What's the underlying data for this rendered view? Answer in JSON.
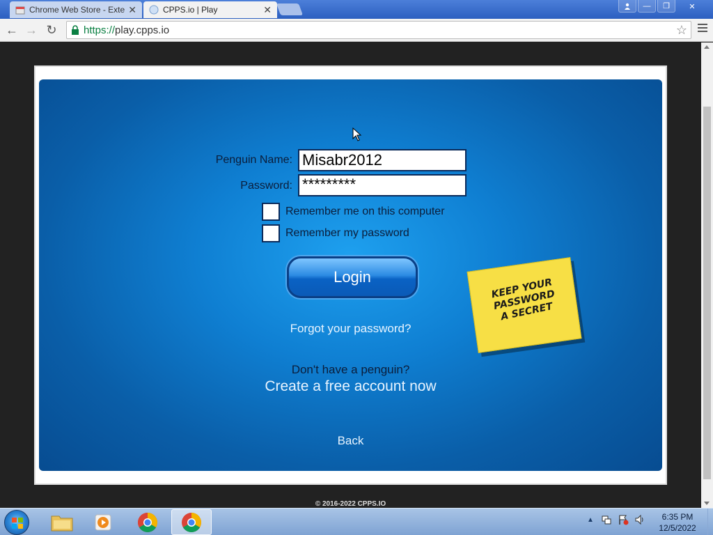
{
  "browser": {
    "tabs": [
      {
        "label": "Chrome Web Store - Exte",
        "active": false
      },
      {
        "label": "CPPS.io | Play",
        "active": true
      }
    ],
    "url_scheme": "https://",
    "url_host": "play.cpps.io"
  },
  "login": {
    "penguin_name_label": "Penguin Name:",
    "penguin_name_value": "Misabr2012",
    "password_label": "Password:",
    "password_value": "*********",
    "remember_me_label": "Remember me on this computer",
    "remember_password_label": "Remember my password",
    "login_button": "Login",
    "forgot_password": "Forgot your password?",
    "no_penguin": "Don't have a penguin?",
    "create_account": "Create a free account now",
    "back": "Back"
  },
  "sticky_note": {
    "line1": "KEEP YOUR",
    "line2": "PASSWORD",
    "line3": "A SECRET"
  },
  "footer": {
    "copyright": "© 2016-2022 CPPS.IO"
  },
  "taskbar": {
    "time": "6:35 PM",
    "date": "12/5/2022"
  },
  "colors": {
    "game_blue": "#0f7fd2",
    "sticky_yellow": "#f7df45",
    "url_green": "#0b8043"
  }
}
